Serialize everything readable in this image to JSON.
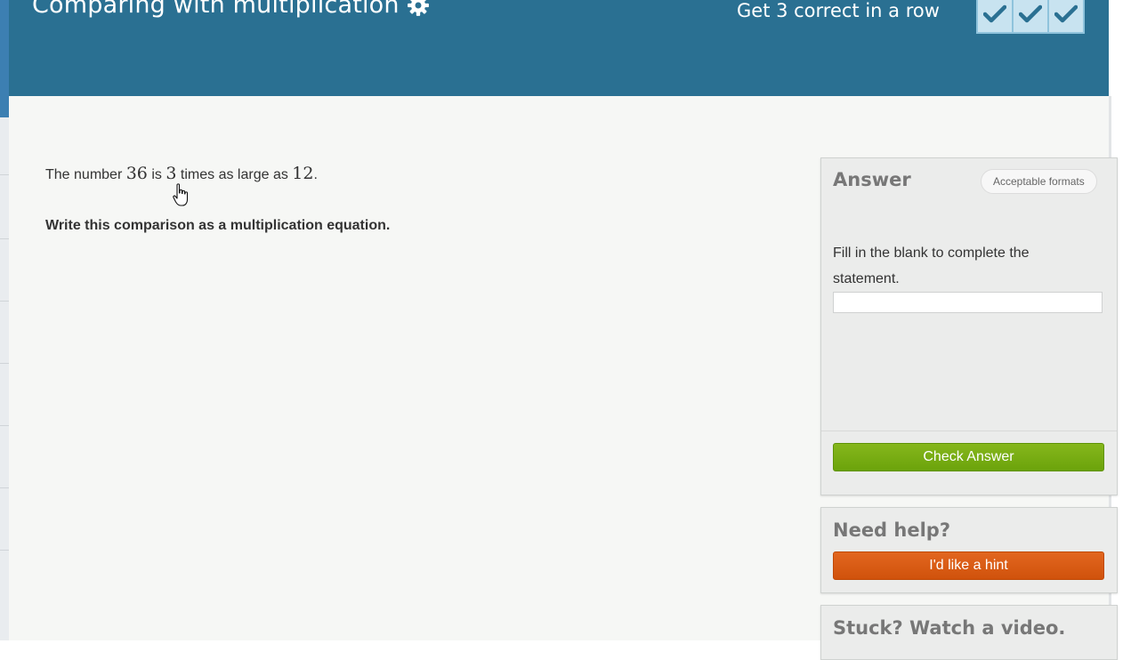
{
  "exercise": {
    "title": "Comparing with multiplication",
    "settings_icon": "gear-icon"
  },
  "streak": {
    "text": "Get 3 correct in a row",
    "completed": 3,
    "total": 3,
    "check_icon": "checkmark-icon"
  },
  "problem": {
    "prefix": "The number ",
    "value_a": "36",
    "text_is": " is ",
    "factor": "3",
    "text_times": " times as large as ",
    "value_b": "12",
    "suffix": ".",
    "question": "Write this comparison as a multiplication equation."
  },
  "answer_panel": {
    "title": "Answer",
    "formats_label": "Acceptable formats",
    "instruction": "Fill in the blank to complete the statement.",
    "input_value": "",
    "check_label": "Check Answer"
  },
  "help_panel": {
    "title": "Need help?",
    "hint_label": "I'd like a hint"
  },
  "video_panel": {
    "title": "Stuck? Watch a video."
  },
  "colors": {
    "header": "#2a7092",
    "content_bg": "#f6f7f5",
    "check_button": "#78ad14",
    "hint_button": "#d85a14",
    "streak_box": "#c8e3f0",
    "checkmark": "#2a7092"
  }
}
